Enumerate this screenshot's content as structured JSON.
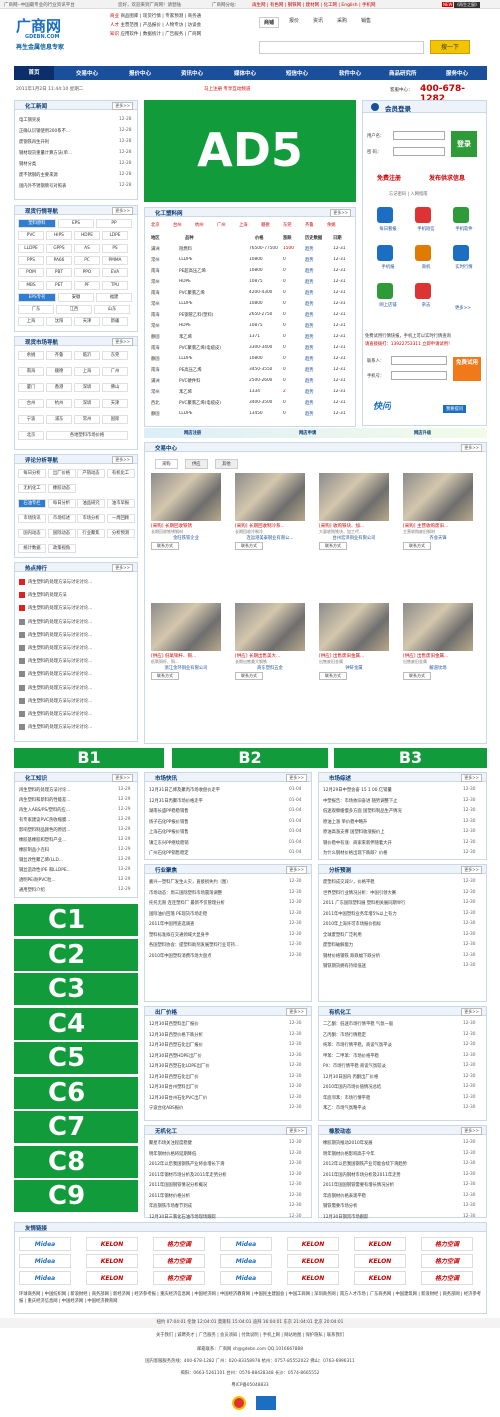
{
  "topbar": {
    "left": "广商网--中国最专业的行业资讯平台",
    "welcome": "您好，欢迎来到广商网！请登陆",
    "links": "广商网分站：",
    "right": "再生网 | 有色网 | 钢铁网 | 建材网 | 化工网 | English | 手机网",
    "badge": "NEW",
    "badge2": "《再生之窗》"
  },
  "logo": {
    "main": "广商网",
    "domain": "GDEBN.COM",
    "slogan": "再生金属信息专家"
  },
  "catlinks": [
    {
      "label": "商业",
      "items": "商品图库 | 现货行情 | 专家预测 | 商务通"
    },
    {
      "label": "人才",
      "items": "主营范围 | 产品报价 | 人物专访 | 访谈会"
    },
    {
      "label": "知识",
      "items": "应用软件 | 数据统计 | 广告服务 | 广商网"
    }
  ],
  "search": {
    "tabs": [
      "商铺",
      "报价",
      "资讯",
      "采购",
      "销售"
    ],
    "placeholder": "",
    "button": "搜一下"
  },
  "nav": {
    "items": [
      "首页",
      "交易中心",
      "报价中心",
      "资讯中心",
      "媒体中心",
      "短信中心",
      "软件中心",
      "商品研究所",
      "服务中心"
    ]
  },
  "subbar": {
    "date": "2011年1月2日 11:44:10 星期二",
    "ticker": "马上注册 专享互动频道",
    "hotline_label": "客服中心：",
    "hotline": "400-678-1282"
  },
  "ads": {
    "ad5": "AD5",
    "b1": "B1",
    "b2": "B2",
    "b3": "B3",
    "c": [
      "C1",
      "C2",
      "C3",
      "C4",
      "C5",
      "C6",
      "C7",
      "C8",
      "C9"
    ]
  },
  "news": {
    "title": "化工新闻",
    "more": "更多>>",
    "items": [
      [
        "电工钢突发",
        "12-28"
      ],
      [
        "正确认识钢使用200系不...",
        "12-28"
      ],
      [
        "废钢铁再生开利",
        "12-28"
      ],
      [
        "钢材现货重量计算方法(单...",
        "12-28"
      ],
      [
        "钢材分类",
        "12-28"
      ],
      [
        "废不锈钢的主要来源",
        "12-28"
      ],
      [
        "国内外不锈钢牌号对照表",
        "12-28"
      ]
    ]
  },
  "login": {
    "title": "会员登录",
    "user_label": "用户名：",
    "pass_label": "密 码：",
    "btn": "登录",
    "register": "免费注册",
    "publish": "发布供求信息",
    "forgot": "忘记密码 | 入网指南",
    "icons": [
      "每日看报",
      "手机短信",
      "手机软件",
      "手机报",
      "商机",
      "实时行情",
      "网上店铺",
      "杂志"
    ],
    "more": "更多>>",
    "hint": "免费试用行情快报，手机上可以实时行情查询",
    "tel": "请直接拨打：13922753311 立即申请试用！",
    "contact": "联系人：",
    "phone": "手机号：",
    "trial": "免费试用",
    "kuaiwen": "快问",
    "ask": "我要提问"
  },
  "spot": {
    "title": "现货行情导航",
    "more": "更多>>",
    "rows": [
      [
        "塑料原料",
        "EPS",
        "PP"
      ],
      [
        "PVC",
        "HIPS",
        "HDPE",
        "LDPE"
      ],
      [
        "LLDPE",
        "GPPS",
        "AS",
        "PS"
      ],
      [
        "PPS",
        "PA66",
        "PC",
        "PMMA"
      ],
      [
        "POM",
        "PBT",
        "PPO",
        "EVA"
      ],
      [
        "MBS",
        "PET",
        "PF",
        "TPU"
      ],
      [
        "EPS专刊",
        "安徽",
        "福建"
      ],
      [
        "广东",
        "江西",
        "山东"
      ],
      [
        "上海",
        "沈阳",
        "天津",
        "新疆"
      ]
    ]
  },
  "mkt": {
    "title": "现货市场导航",
    "more": "更多>>",
    "rows": [
      [
        "余姚",
        "齐鲁",
        "临沂",
        "东莞"
      ],
      [
        "南海",
        "顺德",
        "上海",
        "广州"
      ],
      [
        "厦门",
        "香港",
        "深圳",
        "佛山"
      ],
      [
        "台州",
        "杭州",
        "深圳",
        "天津"
      ],
      [
        "宁波",
        "浦东",
        "常州",
        "国际"
      ],
      [
        "北京",
        "各地塑料市场价格"
      ]
    ]
  },
  "plastic": {
    "title": "化工塑料网",
    "more": "更多>>",
    "tabs": [
      "北京",
      "台州",
      "杭州",
      "广州",
      "上海",
      "顺德",
      "东莞",
      "齐鲁",
      "余姚"
    ],
    "headers": [
      "地区",
      "品种",
      "价格",
      "涨跌",
      "历史数据",
      "日期"
    ],
    "rows": [
      [
        "满洲",
        "阻燃料",
        "76500-77500",
        "1500",
        "趋势",
        "12-31"
      ],
      [
        "常州",
        "LLDPE",
        "10800",
        "0",
        "趋势",
        "12-31"
      ],
      [
        "南海",
        "PE超高压乙烯",
        "10800",
        "0",
        "趋势",
        "12-31"
      ],
      [
        "常州",
        "HDPE",
        "10875",
        "0",
        "趋势",
        "12-31"
      ],
      [
        "南海",
        "PVC聚氯乙烯",
        "4200-4300",
        "0",
        "趋势",
        "12-31"
      ],
      [
        "常州",
        "LLDPE",
        "10800",
        "0",
        "趋势",
        "12-31"
      ],
      [
        "南海",
        "PE钢管乙料(塑料)",
        "2650-2750",
        "0",
        "趋势",
        "12-31"
      ],
      [
        "常州",
        "HDPE",
        "10875",
        "0",
        "趋势",
        "12-31"
      ],
      [
        "静固",
        "苯乙烯",
        "1371",
        "0",
        "趋势",
        "12-31"
      ],
      [
        "南海",
        "PVC聚氯乙烯(电缆皮)",
        "3300-3400",
        "0",
        "趋势",
        "12-31"
      ],
      [
        "静固",
        "LLDPE",
        "10800",
        "0",
        "趋势",
        "12-31"
      ],
      [
        "南海",
        "PE高压乙烯",
        "3450-3550",
        "0",
        "趋势",
        "12-31"
      ],
      [
        "满洲",
        "PVC硬件料",
        "2500-2600",
        "0",
        "趋势",
        "12-31"
      ],
      [
        "常州",
        "苯乙烯",
        "1334",
        "2",
        "趋势",
        "12-31"
      ],
      [
        "西北",
        "PVC聚氯乙烯(电缆皮)",
        "3400-3500",
        "0",
        "趋势",
        "12-31"
      ],
      [
        "静固",
        "LLDPE",
        "13450",
        "0",
        "趋势",
        "12-31"
      ]
    ]
  },
  "banner3": [
    "网店注册",
    "网店申请",
    "网店升级"
  ],
  "review": {
    "title": "评论分析导航",
    "more": "更多>>",
    "rows": [
      [
        "每日分析",
        "出厂价格",
        "产销动态",
        "有机化工"
      ],
      [
        "无机化工",
        "橡胶动态"
      ],
      [
        "石油专栏",
        "每日分析",
        "油品研究",
        "油市早报"
      ],
      [
        "市场快讯",
        "市场综述",
        "市场分析",
        "一周回顾"
      ],
      [
        "国内动态",
        "国际动态",
        "行业聚焦",
        "分析预测"
      ],
      [
        "统计数据",
        "政策视角"
      ]
    ]
  },
  "hot": {
    "title": "热点排行",
    "more": "更多>>",
    "items": [
      "再生塑料的处理方法与讨论讨论...",
      "再生塑料的处理方法",
      "再生塑料的处理方法与讨论讨论...",
      "再生塑料的处理方法与讨论讨论...",
      "再生塑料的处理方法与讨论讨论...",
      "再生塑料的处理方法与讨论讨论...",
      "再生塑料的处理方法与讨论讨论...",
      "再生塑料的处理方法与讨论讨论...",
      "再生塑料的处理方法与讨论讨论...",
      "再生塑料的处理方法与讨论讨论...",
      "再生塑料的处理方法与讨论讨论...",
      "再生塑料的处理方法与讨论讨论..."
    ]
  },
  "trade": {
    "title": "交易中心",
    "tabs": [
      "采购",
      "供应",
      "其他"
    ],
    "more": "更多>>",
    "products": [
      {
        "name": "[采购] 长期回收铁锈",
        "desc": "长期回收铁锈钢材",
        "co": "金旺铁铁企业",
        "ct": "联系方式"
      },
      {
        "name": "[采购] 长期回收制冷系...",
        "desc": "长期回收冷制冷",
        "co": "连运港美泰钢业有限公...",
        "ct": "联系方式"
      },
      {
        "name": "[采购] 收购铁块、加...",
        "desc": "大量收购铁块，加工代...",
        "co": "台州宏泽铜业有限公司",
        "ct": "联系方式"
      },
      {
        "name": "[采购] 主营收购废旧...",
        "desc": "主营收购废旧钢材",
        "co": "齐会天锋",
        "ct": "联系方式"
      },
      {
        "name": "[供应] 低氧铜杆、铜...",
        "desc": "低氧铜杆、铜...",
        "co": "浙江金环铜业有限公司",
        "ct": "联系方式"
      },
      {
        "name": "[供应] 长期出售美大...",
        "desc": "长期出售美大钢铁",
        "co": "商东塑料五金",
        "ct": "联系方式"
      },
      {
        "name": "[供应] 出售废旧金属...",
        "desc": "出售废旧金属",
        "co": "钟轩金属",
        "ct": "联系方式"
      },
      {
        "name": "[供应] 出售废旧金属...",
        "desc": "出售废旧金属",
        "co": "解道坎场",
        "ct": "联系方式"
      }
    ]
  },
  "knowledge": {
    "title": "化工知识",
    "more": "更多>>",
    "items": [
      [
        "再生塑料的处理方法讨论...",
        "12-29"
      ],
      [
        "再生塑料和新料的性能差...",
        "12-29"
      ],
      [
        "再生入ABS/PS/塑料的应...",
        "12-29"
      ],
      [
        "有专家建议PVC热收缩膜...",
        "12-29"
      ],
      [
        "影响塑料制品颜色的原因...",
        "12-29"
      ],
      [
        "橡胶基橡胶和塑料产业...",
        "12-29"
      ],
      [
        "橡胶制品小百科",
        "12-29"
      ],
      [
        "钢丝改性聚乙烯(LLD...",
        "12-29"
      ],
      [
        "钢丝造改性(PE 和LLDPE...",
        "12-29"
      ],
      [
        "透明PE/耐PVC粒...",
        "12-29"
      ],
      [
        "通用塑料介绍",
        "12-29"
      ]
    ]
  },
  "kuaixun": {
    "title": "市场快讯",
    "more": "更多>>",
    "items": [
      [
        "12月31日乙烯及聚丙市场收盘价走平",
        "01-04"
      ],
      [
        "12月31日丙聚市场价格走平",
        "01-04"
      ],
      [
        "湖南长盛PP稳稳销售",
        "01-04"
      ],
      [
        "扬子石化PP报价销售",
        "01-04"
      ],
      [
        "上海石化PP报价销售",
        "01-04"
      ],
      [
        "镇江东兴PP继续稳销",
        "01-04"
      ],
      [
        "广州石化PP销售稳定",
        "01-04"
      ]
    ]
  },
  "zongshu": {
    "title": "市场综述",
    "more": "更多>>",
    "items": [
      [
        "12月29日中塑会奋 15 1 00 亿销量",
        "12-30"
      ],
      [
        "中塑报告：市场依旧奋进 随势调整下止",
        "12-30"
      ],
      [
        "低迷观察缓慢多方面 国塑料制品生产情况",
        "12-30"
      ],
      [
        "原油上涨 单价稳中略升",
        "12-30"
      ],
      [
        "原油高涨支撑 国塑料收涨报价上",
        "12-30"
      ],
      [
        "钢价稳中有涨：商家来新伴随着大开",
        "12-30"
      ],
      [
        "为什么钢材价格出现下跌跌？价格",
        "12-30"
      ]
    ]
  },
  "juJiao": {
    "title": "行业聚焦",
    "more": "更多>>",
    "items": [
      [
        "嘉兴一塑料厂发生火灾，直接损失约（图）",
        "12-30"
      ],
      [
        "市场动态：周三国际塑料市场震荡调整",
        "12-30"
      ],
      [
        "托托无限 连连塑料厂 最新不仅管理分析",
        "12-30"
      ],
      [
        "国际油价回落 PE现货市场走稳",
        "12-30"
      ],
      [
        "2011年中国用途选调查",
        "12-30"
      ],
      [
        "塑料标准拟在交通领域大显身手",
        "12-30"
      ],
      [
        "各国塑料协会：提塑料助剂发展塑料行业可持...",
        "12-30"
      ],
      [
        "2010年中国塑料消费市场大盘点",
        "12-30"
      ]
    ]
  },
  "yuce": {
    "title": "分析预测",
    "more": "更多>>",
    "items": [
      [
        "废塑料成交减少，价格平稳",
        "12-30"
      ],
      [
        "世界塑料行业情况分析：中国引领大赛",
        "12-30"
      ],
      [
        "2011 广东国际塑料展 塑料相关展同期举行",
        "12-30"
      ],
      [
        "2011年中国塑料业务年增5%以上有力",
        "12-30"
      ],
      [
        "2010年上海许可市场报价指标",
        "12-30"
      ],
      [
        "全球废塑料广泛利用",
        "12-30"
      ],
      [
        "废塑料破解能力",
        "12-30"
      ],
      [
        "钢材价格钢铁 跌跌幅下跌分析",
        "12-30"
      ],
      [
        "钢铁期货拥有持续低迷",
        "12-30"
      ]
    ]
  },
  "chuchang": {
    "title": "出厂价格",
    "more": "更多>>",
    "items": [
      [
        "12月30日西塑料出厂报价",
        "12-30"
      ],
      [
        "12月30日西塑价格下跌分析",
        "12-30"
      ],
      [
        "12月30日西塑石化出厂报价",
        "12-30"
      ],
      [
        "12月30日西塑HDPE出厂价",
        "12-30"
      ],
      [
        "12月30日西塑石化LDPE出厂价",
        "12-30"
      ],
      [
        "12月30日西塑石化出厂价",
        "12-30"
      ],
      [
        "12月30日台州塑料出厂价",
        "12-30"
      ],
      [
        "12月30日台州石化PVC出厂价",
        "12-30"
      ],
      [
        "宁波台化ABS报价",
        "12-30"
      ]
    ]
  },
  "youji": {
    "title": "有机化工",
    "more": "更多>>",
    "items": [
      [
        "二乙酮：低迷市场行情平稳 气氛一般",
        "12-30"
      ],
      [
        "乙丙酮：市场行情稳定",
        "12-30"
      ],
      [
        "纯苯：市场行情平稳，商谈气氛平淡",
        "12-30"
      ],
      [
        "甲苯：二甲苯：市场价格平稳",
        "12-30"
      ],
      [
        "PX：市场行情平稳 商谈气氛较淡",
        "12-30"
      ],
      [
        "12月30日国内 丙酮出厂价格",
        "12-30"
      ],
      [
        "2010年国内市场价值情况总结",
        "12-30"
      ],
      [
        "年底邻苯：市场行情平稳",
        "12-30"
      ],
      [
        "苯乙：市场气氛略平淡",
        "12-30"
      ]
    ]
  },
  "wuji": {
    "title": "无机化工",
    "more": "更多>>",
    "items": [
      [
        "聚星市场关注程度稳健",
        "12-30"
      ],
      [
        "明年钢材价格将延期降低",
        "12-30"
      ],
      [
        "2012年以后我国钢铁产业将会增长下滑",
        "12-30"
      ],
      [
        "2011年钢材市场分析及2011年走势分析",
        "12-30"
      ],
      [
        "2011年国国钢铁情况分析概况",
        "12-30"
      ],
      [
        "2011年钢材价格分析",
        "12-30"
      ],
      [
        "年底钢铁市场春节到成",
        "12-30"
      ],
      [
        "12月30日三氯化石油市场现场跟踪",
        "12-30"
      ]
    ]
  },
  "xiangjiao": {
    "title": "橡胶动态",
    "more": "更多>>",
    "items": [
      [
        "橡胶期货推动2010年发展",
        "12-30"
      ],
      [
        "明年钢材价格影响高于今年",
        "12-30"
      ],
      [
        "2012年以后我国钢铁产业可能会续下滑趋势",
        "12-30"
      ],
      [
        "2011年国内钢材市场分析及2011年走势",
        "12-30"
      ],
      [
        "2011年国国钢铁需要有增长情况分析",
        "12-30"
      ],
      [
        "年底钢材价格表现平稳",
        "12-30"
      ],
      [
        "钢铁需要市场分析",
        "12-30"
      ],
      [
        "12月30日钢贸市场跟踪",
        "12-30"
      ]
    ]
  },
  "links": {
    "title": "友情链接",
    "logos": [
      "Midea",
      "KELON",
      "格力空调",
      "Midea",
      "KELON",
      "KELON",
      "格力空调"
    ],
    "text": "环球商务网 | 中国纺织网 | 新浪财经 | 商务部网 | 新经济网 | 经济参考报 | 重庆经济信息网 | 中国经济网 | 中国经济教育网 | 中国民主建国会 | 中国工商网 | 深圳商务网 | 南方人才市场 | 广东商务网 | 中国建筑网 | 新浪财经 | 商务部网 | 经济参考报 | 重庆经济信息网 | 中国经济网 | 中国经济教育网"
  },
  "clock": "纽约 07:04:01 伦敦 12:04:01 莫斯科 15:04:01 迪拜 16:04:01 东京 21:04:01 北京 20:04:01",
  "footer": {
    "links": "关于我们 | 诚聘英才 | 广告服务 | 会员须知 | 付款说明 | 手机上网 | 网站地图 | 保护隐私 | 联系我们",
    "email": "邮箱联系：广商网 sh@gdebn.com QQ:1016667888",
    "tel": "国内客服服务热线：400-678-1282 广州：020-83358978 杭州：0757-85552022 佛山：0763-6996311",
    "tel2": "揭阳：0663-5261101 台州：0576-88428348 长沙：0574-8665552",
    "icp": "粤ICP备05048833"
  }
}
